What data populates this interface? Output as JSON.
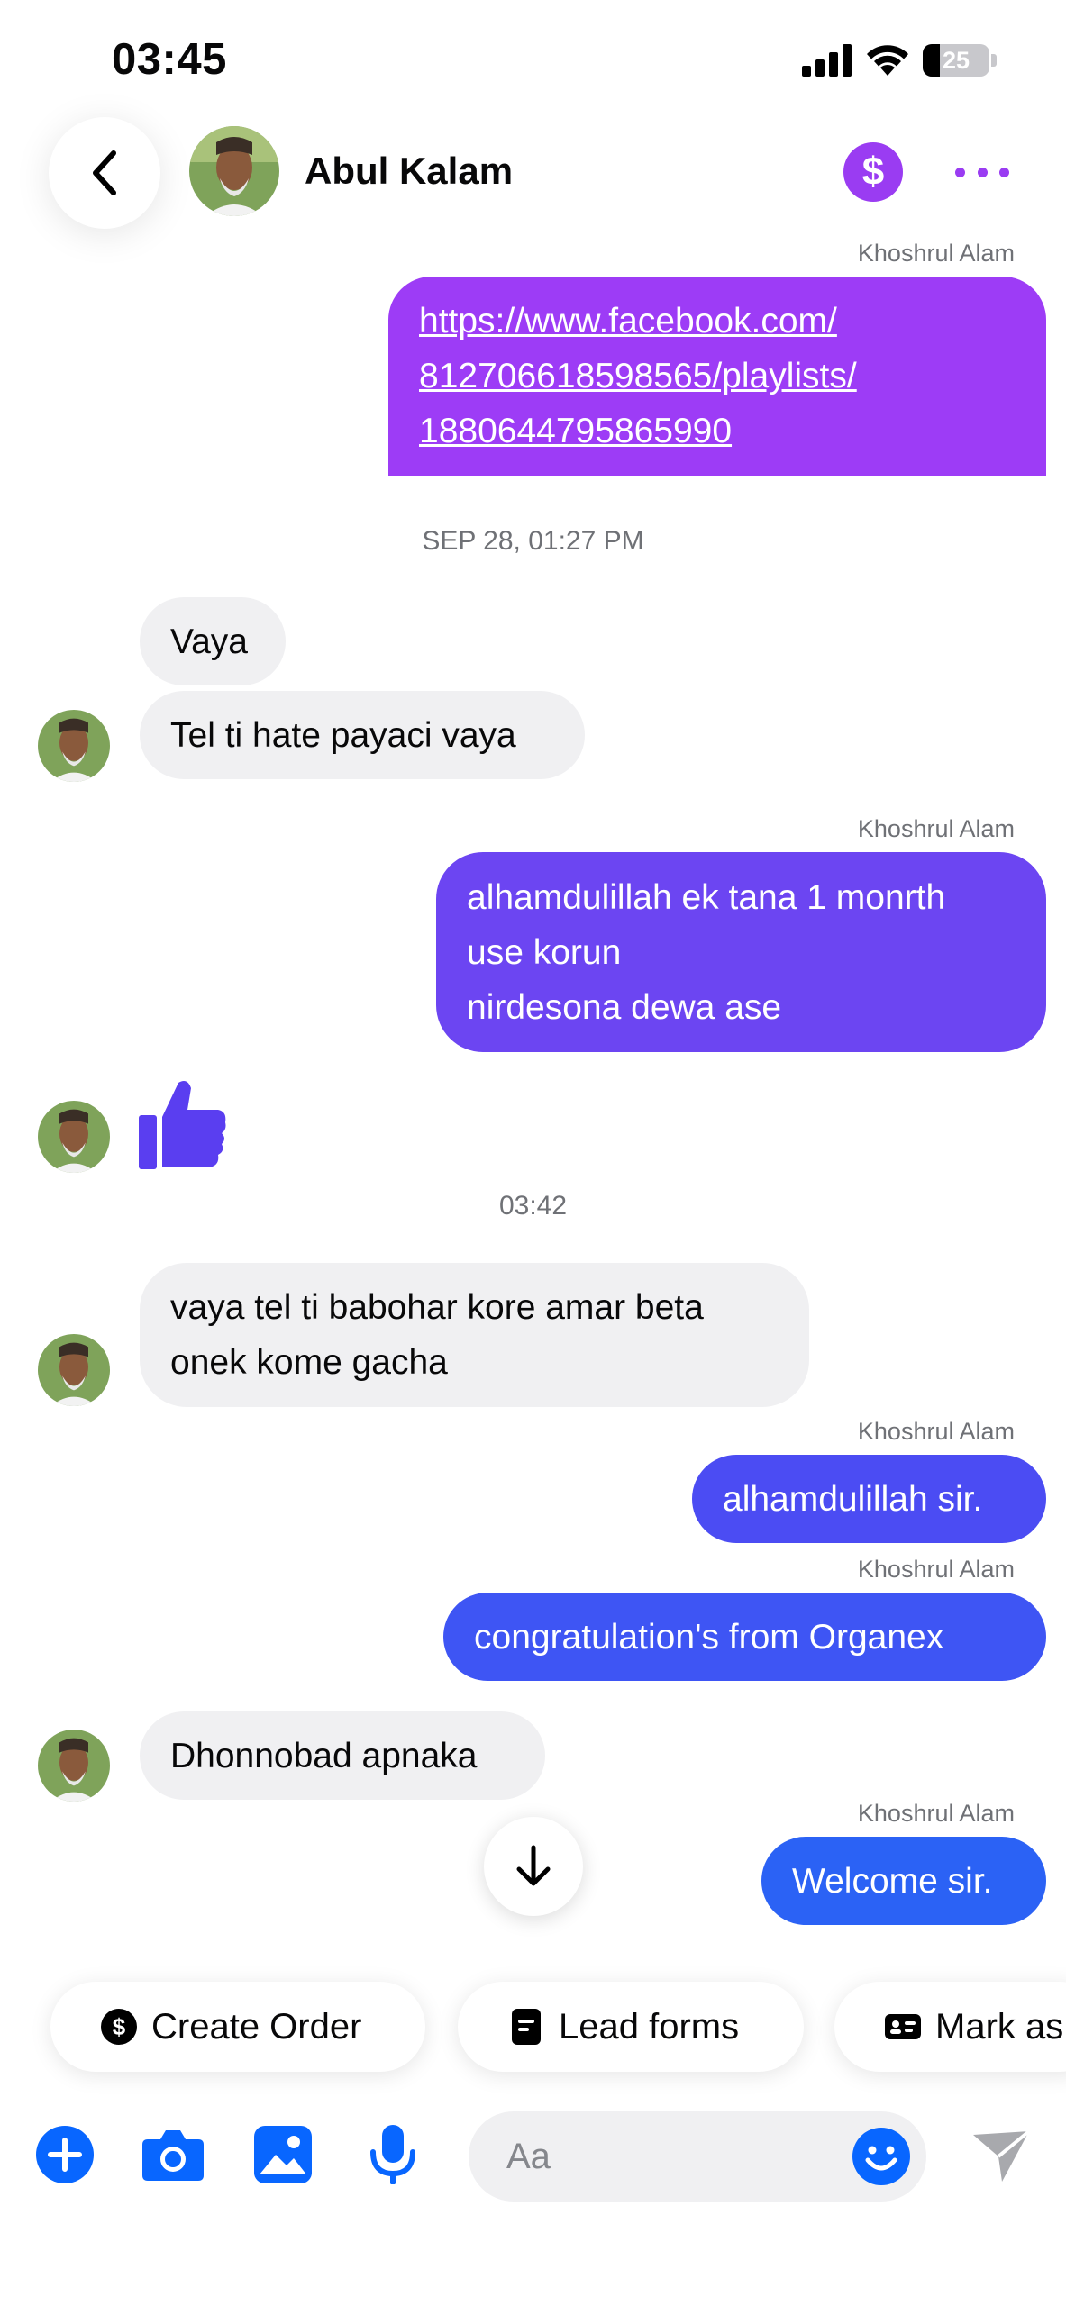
{
  "status_bar": {
    "time": "03:45",
    "battery": "25",
    "battery_level": 0.25
  },
  "header": {
    "contact_name": "Abul Kalam",
    "pay_icon": "dollar-icon",
    "more_icon": "more-icon"
  },
  "colors": {
    "accent": "#0866ff",
    "purple": "#9a3cf2",
    "bubble_in": "#f0f0f2",
    "bubble_link": "#9d3cf6",
    "bubble_violet": "#6c45f2",
    "bubble_indigo": "#4b4cf3",
    "bubble_blue": "#365cf4",
    "bubble_blue2": "#2b62f5"
  },
  "messages": [
    {
      "sender": "Khoshrul Alam",
      "lines": [
        "https://www.facebook.com/",
        "812706618598565/playlists/",
        "1880644795865990"
      ]
    },
    {
      "timestamp": "SEP 28, 01:27 PM"
    },
    {
      "text": "Vaya"
    },
    {
      "text": "Tel ti hate payaci vaya"
    },
    {
      "sender": "Khoshrul Alam",
      "lines": [
        "alhamdulillah ek tana 1 monrth",
        "use korun",
        "nirdesona dewa ase"
      ]
    },
    {
      "reaction": "thumbs-up-icon"
    },
    {
      "timestamp": "03:42"
    },
    {
      "lines": [
        "vaya tel ti babohar kore amar beta",
        "onek kome gacha"
      ]
    },
    {
      "sender": "Khoshrul Alam",
      "text": "alhamdulillah sir."
    },
    {
      "sender": "Khoshrul Alam",
      "text": "congratulation's from Organex"
    },
    {
      "text": "Dhonnobad apnaka"
    },
    {
      "sender": "Khoshrul Alam",
      "text": "Welcome sir."
    }
  ],
  "quick_actions": [
    {
      "label": "Create Order",
      "icon": "dollar-circle-icon"
    },
    {
      "label": "Lead forms",
      "icon": "form-icon"
    },
    {
      "label": "Mark as",
      "icon": "id-card-icon"
    }
  ],
  "composer": {
    "placeholder": "Aa"
  }
}
